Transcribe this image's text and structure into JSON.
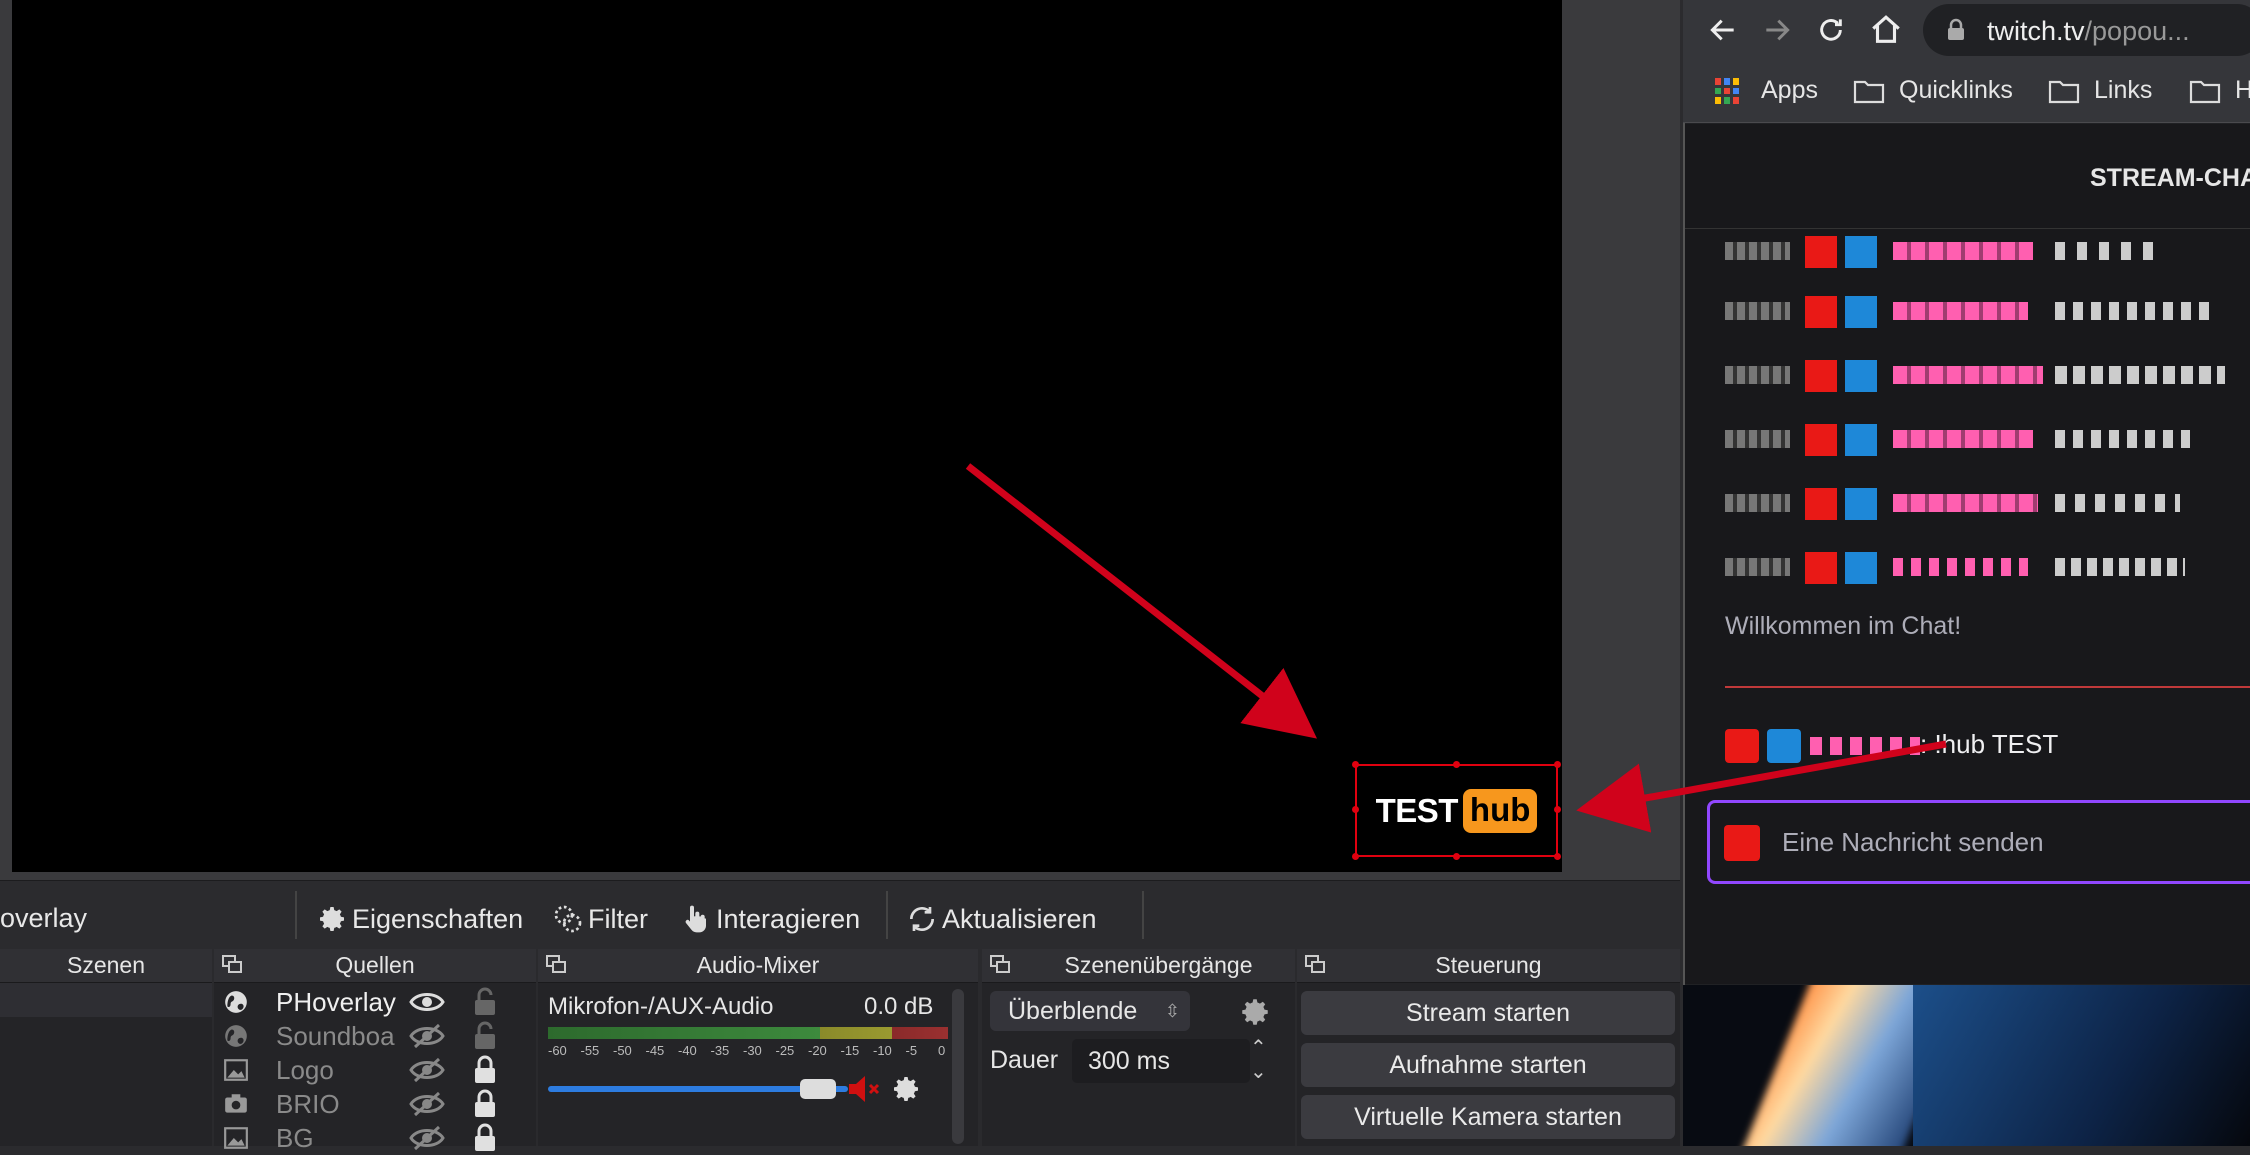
{
  "obs": {
    "toolbar": {
      "scene_name": "overlay",
      "properties": "Eigenschaften",
      "filters": "Filter",
      "interact": "Interagieren",
      "refresh": "Aktualisieren"
    },
    "preview_source": {
      "test": "TEST",
      "hub": "hub"
    },
    "docks": {
      "scenes": "Szenen",
      "sources": "Quellen",
      "audio_mixer": "Audio-Mixer",
      "transitions": "Szenenübergänge",
      "controls": "Steuerung"
    },
    "sources": [
      {
        "name": "PHoverlay",
        "icon": "globe-icon",
        "visible": true,
        "locked": false
      },
      {
        "name": "Soundboard",
        "icon": "globe-icon",
        "visible": false,
        "locked": false
      },
      {
        "name": "Logo",
        "icon": "image-icon",
        "visible": false,
        "locked": true
      },
      {
        "name": "BRIO",
        "icon": "camera-icon",
        "visible": false,
        "locked": true
      },
      {
        "name": "BG",
        "icon": "image-icon",
        "visible": false,
        "locked": true
      }
    ],
    "mixer": {
      "channel": "Mikrofon-/AUX-Audio",
      "level": "0.0 dB",
      "scale": [
        "-60",
        "-55",
        "-50",
        "-45",
        "-40",
        "-35",
        "-30",
        "-25",
        "-20",
        "-15",
        "-10",
        "-5",
        "0"
      ],
      "volume_fraction": 0.93,
      "muted": true
    },
    "transitions": {
      "selected": "Überblende",
      "duration_label": "Dauer",
      "duration_value": "300 ms"
    },
    "controls": {
      "stream": "Stream starten",
      "record": "Aufnahme starten",
      "virtual_cam": "Virtuelle Kamera starten"
    }
  },
  "browser": {
    "url_host": "twitch.tv",
    "url_path": "/popou...",
    "bookmarks": [
      "Apps",
      "Quicklinks",
      "Links",
      "H"
    ],
    "chat": {
      "header": "STREAM-CHA",
      "welcome": "Willkommen im Chat!",
      "last_message": ": !hub TEST",
      "input_placeholder": "Eine Nachricht senden"
    }
  },
  "colors": {
    "accent_red": "#e0000f",
    "hub_orange": "#f7971d",
    "twitch_purple": "#9147ff",
    "badge_red": "#e91916",
    "badge_blue": "#1e88d8",
    "name_pink": "#ff69b4"
  }
}
